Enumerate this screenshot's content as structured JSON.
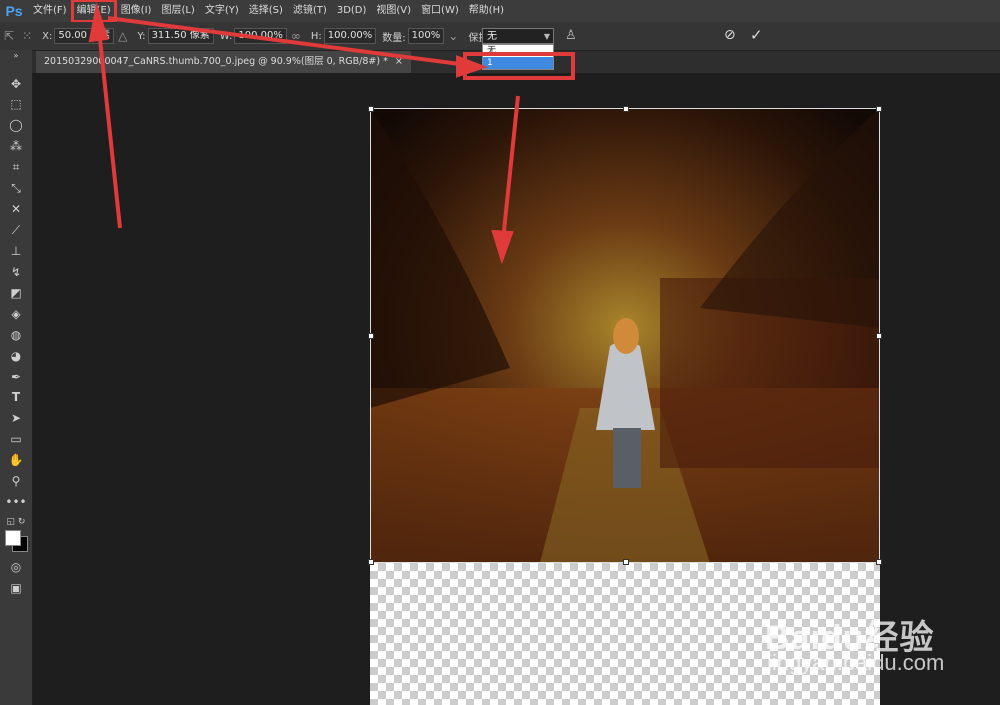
{
  "app": {
    "logo": "Ps"
  },
  "menu": [
    "文件(F)",
    "编辑(E)",
    "图像(I)",
    "图层(L)",
    "文字(Y)",
    "选择(S)",
    "滤镜(T)",
    "3D(D)",
    "视图(V)",
    "窗口(W)",
    "帮助(H)"
  ],
  "options": {
    "x_label": "X:",
    "x_value": "50.00 像素",
    "y_label": "Y:",
    "y_value": "311.50 像素",
    "w_label": "W:",
    "w_value": "100.00%",
    "h_label": "H:",
    "h_value": "100.00%",
    "amount_label": "数量:",
    "amount_value": "100%",
    "protect_label": "保护:",
    "protect_value": "无",
    "cancel_icon": "cancel-icon",
    "commit_icon": "checkmark-icon"
  },
  "dropdown": {
    "options": [
      "无",
      "1"
    ],
    "selected_index": 1
  },
  "document_tab": {
    "title": "20150329000047_CaNRS.thumb.700_0.jpeg @ 90.9%(图层 0, RGB/8#) *",
    "close": "×"
  },
  "tools": [
    "move-icon",
    "marquee-icon",
    "lasso-icon",
    "magic-wand-icon",
    "crop-icon",
    "eyedropper-icon",
    "healing-brush-icon",
    "brush-icon",
    "clone-stamp-icon",
    "history-brush-icon",
    "eraser-icon",
    "paint-bucket-icon",
    "blur-icon",
    "dodge-icon",
    "pen-icon",
    "type-icon",
    "path-select-icon",
    "rectangle-icon",
    "hand-icon",
    "zoom-icon",
    "more-icon",
    "swap-colors-icon",
    "foreground-color-icon",
    "quick-mask-icon",
    "screen-mode-icon"
  ],
  "tool_glyphs": {
    "type": "T"
  },
  "watermark": {
    "main": "Baidu经验",
    "sub": "jingyan.baidu.com"
  },
  "colors": {
    "annotation": "#e03a3a",
    "accent": "#3f8ae0",
    "foreground": "#ffffff",
    "background": "#000000"
  }
}
